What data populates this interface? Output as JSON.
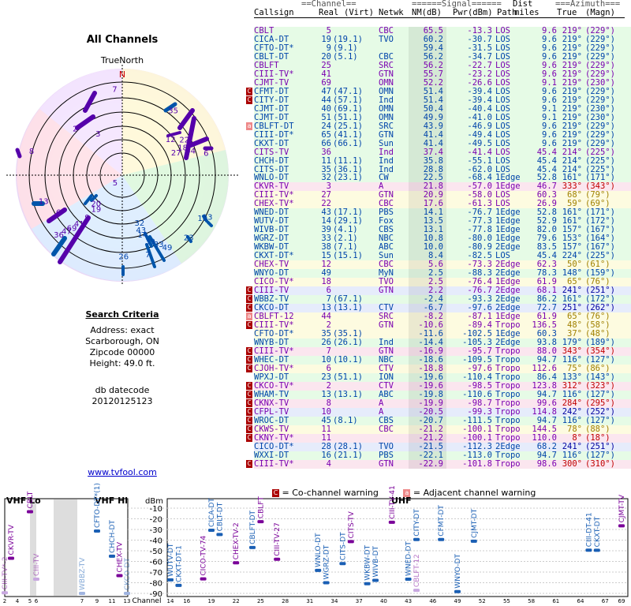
{
  "left": {
    "title": "All Channels",
    "north_label": "TrueNorth",
    "n_label": "N",
    "criteria_title": "Search Criteria",
    "address": "Address: exact",
    "city": "Scarborough, ON",
    "zipcode": "Zipcode 00000",
    "height": "Height: 49.0 ft.",
    "db_label": "db datecode",
    "db_code": "20120125123",
    "link": "www.tvfool.com"
  },
  "table": {
    "group_headers": {
      "channel": "==Channel==",
      "signal": "======Signal======",
      "azimuth": "===Azimuth==="
    },
    "headers": [
      "Callsign",
      "Real",
      "(Virt)",
      "Netwk",
      "NM(dB)",
      "Pwr(dBm)",
      "Path",
      "Dist",
      "miles",
      "True",
      "(Magn)"
    ],
    "rows": [
      [
        "CBLT",
        "5",
        "",
        "CBC",
        "65.5",
        "-13.3",
        "LOS",
        "9.6",
        "219°",
        "(229°)",
        "g",
        "",
        "violet"
      ],
      [
        "CICA-DT",
        "19",
        "(19.1)",
        "TVO",
        "60.2",
        "-30.7",
        "LOS",
        "9.6",
        "219°",
        "(229°)",
        "g",
        "",
        "blue"
      ],
      [
        "CFTO-DT*",
        "9",
        "(9.1)",
        "",
        "59.4",
        "-31.5",
        "LOS",
        "9.6",
        "219°",
        "(229°)",
        "g",
        "",
        "blue"
      ],
      [
        "CBLT-DT",
        "20",
        "(5.1)",
        "CBC",
        "56.2",
        "-34.7",
        "LOS",
        "9.6",
        "219°",
        "(229°)",
        "g",
        "",
        "blue"
      ],
      [
        "CBLFT",
        "25",
        "",
        "SRC",
        "56.2",
        "-22.7",
        "LOS",
        "9.6",
        "219°",
        "(229°)",
        "g",
        "",
        "violet"
      ],
      [
        "CIII-TV*",
        "41",
        "",
        "GTN",
        "55.7",
        "-23.2",
        "LOS",
        "9.6",
        "219°",
        "(229°)",
        "g",
        "",
        "violet"
      ],
      [
        "CJMT-TV",
        "69",
        "",
        "OMN",
        "52.2",
        "-26.6",
        "LOS",
        "9.1",
        "219°",
        "(230°)",
        "g",
        "",
        "violet"
      ],
      [
        "CFMT-DT",
        "47",
        "(47.1)",
        "OMN",
        "51.4",
        "-39.4",
        "LOS",
        "9.6",
        "219°",
        "(229°)",
        "g",
        "C",
        "blue"
      ],
      [
        "CITY-DT",
        "44",
        "(57.1)",
        "Ind",
        "51.4",
        "-39.4",
        "LOS",
        "9.6",
        "219°",
        "(229°)",
        "g",
        "C",
        "blue"
      ],
      [
        "CJMT-DT",
        "40",
        "(69.1)",
        "OMN",
        "50.4",
        "-40.4",
        "LOS",
        "9.1",
        "219°",
        "(230°)",
        "g",
        "",
        "blue"
      ],
      [
        "CJMT-DT",
        "51",
        "(51.1)",
        "OMN",
        "49.9",
        "-41.0",
        "LOS",
        "9.1",
        "219°",
        "(230°)",
        "g",
        "",
        "blue"
      ],
      [
        "CBLFT-DT",
        "24",
        "(25.1)",
        "SRC",
        "43.9",
        "-46.9",
        "LOS",
        "9.6",
        "219°",
        "(229°)",
        "g",
        "a",
        "blue"
      ],
      [
        "CIII-DT*",
        "65",
        "(41.1)",
        "GTN",
        "41.4",
        "-49.4",
        "LOS",
        "9.6",
        "219°",
        "(229°)",
        "g",
        "",
        "blue"
      ],
      [
        "CKXT-DT",
        "66",
        "(66.1)",
        "Sun",
        "41.4",
        "-49.5",
        "LOS",
        "9.6",
        "219°",
        "(229°)",
        "g",
        "",
        "blue"
      ],
      [
        "CITS-TV",
        "36",
        "",
        "Ind",
        "37.4",
        "-41.4",
        "LOS",
        "45.4",
        "214°",
        "(225°)",
        "g",
        "",
        "violet"
      ],
      [
        "CHCH-DT",
        "11",
        "(11.1)",
        "Ind",
        "35.8",
        "-55.1",
        "LOS",
        "45.4",
        "214°",
        "(225°)",
        "g",
        "",
        "blue"
      ],
      [
        "CITS-DT",
        "35",
        "(36.1)",
        "Ind",
        "28.8",
        "-62.0",
        "LOS",
        "45.4",
        "214°",
        "(225°)",
        "g",
        "",
        "blue"
      ],
      [
        "WNLO-DT",
        "32",
        "(23.1)",
        "CW",
        "22.5",
        "-68.4",
        "1Edge",
        "52.8",
        "161°",
        "(171°)",
        "g",
        "",
        "blue"
      ],
      [
        "CKVR-TV",
        "3",
        "",
        "A",
        "21.8",
        "-57.0",
        "1Edge",
        "46.7",
        "333°",
        "(343°)",
        "p",
        "",
        "violet"
      ],
      [
        "CIII-TV*",
        "27",
        "",
        "GTN",
        "20.9",
        "-58.0",
        "LOS",
        "60.3",
        "68°",
        "(79°)",
        "y",
        "",
        "violet"
      ],
      [
        "CHEX-TV*",
        "22",
        "",
        "CBC",
        "17.6",
        "-61.3",
        "LOS",
        "26.9",
        "59°",
        "(69°)",
        "y",
        "",
        "violet"
      ],
      [
        "WNED-DT",
        "43",
        "(17.1)",
        "PBS",
        "14.1",
        "-76.7",
        "1Edge",
        "52.8",
        "161°",
        "(171°)",
        "g",
        "",
        "blue"
      ],
      [
        "WUTV-DT",
        "14",
        "(29.1)",
        "Fox",
        "13.5",
        "-77.3",
        "1Edge",
        "52.9",
        "161°",
        "(172°)",
        "g",
        "",
        "blue"
      ],
      [
        "WIVB-DT",
        "39",
        "(4.1)",
        "CBS",
        "13.1",
        "-77.8",
        "1Edge",
        "82.0",
        "157°",
        "(167°)",
        "g",
        "",
        "blue"
      ],
      [
        "WGRZ-DT",
        "33",
        "(2.1)",
        "NBC",
        "10.8",
        "-80.0",
        "1Edge",
        "79.6",
        "153°",
        "(164°)",
        "g",
        "",
        "blue"
      ],
      [
        "WKBW-DT",
        "38",
        "(7.1)",
        "ABC",
        "10.0",
        "-80.9",
        "2Edge",
        "83.5",
        "157°",
        "(167°)",
        "g",
        "",
        "blue"
      ],
      [
        "CKXT-DT*",
        "15",
        "(15.1)",
        "Sun",
        "8.4",
        "-82.5",
        "LOS",
        "45.4",
        "224°",
        "(225°)",
        "g",
        "",
        "blue"
      ],
      [
        "CHEX-TV",
        "12",
        "",
        "CBC",
        "5.6",
        "-73.3",
        "2Edge",
        "62.3",
        "50°",
        "(61°)",
        "y",
        "",
        "violet"
      ],
      [
        "WNYO-DT",
        "49",
        "",
        "MyN",
        "2.5",
        "-88.3",
        "2Edge",
        "78.3",
        "148°",
        "(159°)",
        "g",
        "",
        "blue"
      ],
      [
        "CICO-TV*",
        "18",
        "",
        "TVO",
        "2.5",
        "-76.4",
        "1Edge",
        "61.9",
        "65°",
        "(76°)",
        "y",
        "",
        "violet"
      ],
      [
        "CIII-TV",
        "6",
        "",
        "GTN",
        "2.2",
        "-76.7",
        "2Edge",
        "68.1",
        "241°",
        "(251°)",
        "b",
        "C",
        "violet"
      ],
      [
        "WBBZ-TV",
        "7",
        "(67.1)",
        "",
        "-2.4",
        "-93.3",
        "2Edge",
        "86.2",
        "161°",
        "(172°)",
        "g",
        "C",
        "blue"
      ],
      [
        "CKCO-DT",
        "13",
        "(13.1)",
        "CTV",
        "-6.7",
        "-97.6",
        "2Edge",
        "72.7",
        "251°",
        "(262°)",
        "b",
        "C",
        "blue"
      ],
      [
        "CBLFT-12",
        "44",
        "",
        "SRC",
        "-8.2",
        "-87.1",
        "1Edge",
        "61.9",
        "65°",
        "(76°)",
        "y",
        "a",
        "violet"
      ],
      [
        "CIII-TV*",
        "2",
        "",
        "GTN",
        "-10.6",
        "-89.4",
        "Tropo",
        "136.5",
        "48°",
        "(58°)",
        "y",
        "C",
        "violet"
      ],
      [
        "CFTO-DT*",
        "35",
        "(35.1)",
        "",
        "-11.6",
        "-102.5",
        "1Edge",
        "60.3",
        "37°",
        "(48°)",
        "y",
        "",
        "blue"
      ],
      [
        "WNYB-DT",
        "26",
        "(26.1)",
        "Ind",
        "-14.4",
        "-105.3",
        "2Edge",
        "93.8",
        "179°",
        "(189°)",
        "g",
        "",
        "blue"
      ],
      [
        "CIII-TV*",
        "7",
        "",
        "GTN",
        "-16.9",
        "-95.7",
        "Tropo",
        "88.0",
        "343°",
        "(354°)",
        "p",
        "C",
        "violet"
      ],
      [
        "WHEC-DT",
        "10",
        "(10.1)",
        "NBC",
        "-18.6",
        "-109.5",
        "Tropo",
        "94.7",
        "116°",
        "(127°)",
        "g",
        "C",
        "blue"
      ],
      [
        "CJOH-TV*",
        "6",
        "",
        "CTV",
        "-18.8",
        "-97.6",
        "Tropo",
        "112.6",
        "75°",
        "(86°)",
        "y",
        "C",
        "violet"
      ],
      [
        "WPXJ-DT",
        "23",
        "(51.1)",
        "ION",
        "-19.6",
        "-110.4",
        "Tropo",
        "86.4",
        "133°",
        "(143°)",
        "g",
        "",
        "blue"
      ],
      [
        "CKCO-TV*",
        "2",
        "",
        "CTV",
        "-19.6",
        "-98.5",
        "Tropo",
        "123.8",
        "312°",
        "(323°)",
        "p",
        "C",
        "violet"
      ],
      [
        "WHAM-TV",
        "13",
        "(13.1)",
        "ABC",
        "-19.8",
        "-110.6",
        "Tropo",
        "94.7",
        "116°",
        "(127°)",
        "g",
        "C",
        "blue"
      ],
      [
        "CKNX-TV",
        "8",
        "",
        "A",
        "-19.9",
        "-98.7",
        "Tropo",
        "99.6",
        "284°",
        "(295°)",
        "p",
        "C",
        "violet"
      ],
      [
        "CFPL-TV",
        "10",
        "",
        "A",
        "-20.5",
        "-99.3",
        "Tropo",
        "114.8",
        "242°",
        "(252°)",
        "b",
        "C",
        "violet"
      ],
      [
        "WROC-DT",
        "45",
        "(8.1)",
        "CBS",
        "-20.7",
        "-111.5",
        "Tropo",
        "94.7",
        "116°",
        "(127°)",
        "g",
        "C",
        "blue"
      ],
      [
        "CKWS-TV",
        "11",
        "",
        "CBC",
        "-21.2",
        "-100.1",
        "Tropo",
        "144.5",
        "78°",
        "(88°)",
        "y",
        "C",
        "violet"
      ],
      [
        "CKNY-TV*",
        "11",
        "",
        "",
        "-21.2",
        "-100.1",
        "Tropo",
        "110.0",
        "8°",
        "(18°)",
        "p",
        "C",
        "violet"
      ],
      [
        "CICO-DT*",
        "28",
        "(28.1)",
        "TVO",
        "-21.5",
        "-112.3",
        "2Edge",
        "68.2",
        "241°",
        "(251°)",
        "b",
        "",
        "blue"
      ],
      [
        "WXXI-DT",
        "16",
        "(21.1)",
        "PBS",
        "-22.1",
        "-113.0",
        "Tropo",
        "94.7",
        "116°",
        "(127°)",
        "g",
        "",
        "blue"
      ],
      [
        "CIII-TV*",
        "4",
        "",
        "GTN",
        "-22.9",
        "-101.8",
        "Tropo",
        "98.6",
        "300°",
        "(310°)",
        "p",
        "C",
        "violet"
      ]
    ]
  },
  "legend": {
    "co_channel": "= Co-channel warning",
    "adjacent": "= Adjacent channel warning",
    "co_mark": "C",
    "adj_mark": "a"
  },
  "chart_data": {
    "type": "bar",
    "title": "",
    "ylabel": "dBm",
    "ylim": [
      -90,
      -10
    ],
    "yticks": [
      -10,
      -20,
      -30,
      -40,
      -50,
      -60,
      -70,
      -80,
      -90
    ],
    "band_labels": [
      "VHF Lo",
      "VHF Hi",
      "UHF"
    ],
    "x_label": "Channel",
    "x_ticks": [
      2,
      4,
      5,
      6,
      7,
      9,
      11,
      13,
      14,
      16,
      19,
      22,
      25,
      28,
      31,
      34,
      37,
      40,
      43,
      46,
      49,
      52,
      55,
      58,
      61,
      64,
      67,
      69
    ],
    "stations": [
      {
        "ch": 2,
        "pwr": -89.4,
        "label": "CIII-TV*-2",
        "kind": "analog_weak"
      },
      {
        "ch": 3,
        "pwr": -57.0,
        "label": "CKVR-TV",
        "kind": "analog"
      },
      {
        "ch": 5,
        "pwr": -13.3,
        "label": "CBLT",
        "kind": "analog"
      },
      {
        "ch": 6,
        "pwr": -76.7,
        "label": "CIII-TV",
        "kind": "analog_weak"
      },
      {
        "ch": 7,
        "pwr": -93.3,
        "label": "WBBZ-TV",
        "kind": "digital_weak"
      },
      {
        "ch": 9,
        "pwr": -31.5,
        "label": "CFTO-DT*(1)",
        "kind": "digital"
      },
      {
        "ch": 11,
        "pwr": -55.1,
        "label": "CHCH-DT",
        "kind": "digital"
      },
      {
        "ch": 12,
        "pwr": -73.3,
        "label": "CHEX-TV",
        "kind": "analog"
      },
      {
        "ch": 13,
        "pwr": -97.6,
        "label": "CKCO-DT",
        "kind": "digital_weak"
      },
      {
        "ch": 14,
        "pwr": -77.3,
        "label": "WUTV-DT",
        "kind": "digital"
      },
      {
        "ch": 15,
        "pwr": -82.5,
        "label": "CKXT-DT-1",
        "kind": "digital"
      },
      {
        "ch": 18,
        "pwr": -76.4,
        "label": "CICO-TV-74",
        "kind": "analog"
      },
      {
        "ch": 19,
        "pwr": -30.7,
        "label": "CICA-DT",
        "kind": "digital"
      },
      {
        "ch": 20,
        "pwr": -34.7,
        "label": "CBLT-DT",
        "kind": "digital"
      },
      {
        "ch": 22,
        "pwr": -61.3,
        "label": "CHEX-TV-2",
        "kind": "analog"
      },
      {
        "ch": 24,
        "pwr": -46.9,
        "label": "CBLFT-DT",
        "kind": "digital"
      },
      {
        "ch": 25,
        "pwr": -22.7,
        "label": "CBLFT",
        "kind": "analog"
      },
      {
        "ch": 27,
        "pwr": -58.0,
        "label": "CIII-TV-27",
        "kind": "analog"
      },
      {
        "ch": 32,
        "pwr": -68.4,
        "label": "WNLO-DT",
        "kind": "digital"
      },
      {
        "ch": 33,
        "pwr": -80.0,
        "label": "WGRZ-DT",
        "kind": "digital"
      },
      {
        "ch": 35,
        "pwr": -62.0,
        "label": "CITS-DT",
        "kind": "digital"
      },
      {
        "ch": 36,
        "pwr": -41.4,
        "label": "CITS-TV",
        "kind": "analog"
      },
      {
        "ch": 38,
        "pwr": -80.9,
        "label": "WKBW-DT",
        "kind": "digital"
      },
      {
        "ch": 39,
        "pwr": -77.8,
        "label": "WIVB-DT",
        "kind": "digital"
      },
      {
        "ch": 41,
        "pwr": -23.2,
        "label": "CIII-TV-41",
        "kind": "analog"
      },
      {
        "ch": 43,
        "pwr": -76.7,
        "label": "WNED-DT",
        "kind": "digital"
      },
      {
        "ch": 44,
        "pwr": -39.4,
        "label": "CITY-DT",
        "kind": "digital"
      },
      {
        "ch": 44,
        "pwr": -87.1,
        "label": "CBLFT-12",
        "kind": "analog_weak"
      },
      {
        "ch": 47,
        "pwr": -39.4,
        "label": "CFMT-DT",
        "kind": "digital"
      },
      {
        "ch": 49,
        "pwr": -88.3,
        "label": "WNYO-DT",
        "kind": "digital"
      },
      {
        "ch": 51,
        "pwr": -41.0,
        "label": "CJMT-DT",
        "kind": "digital"
      },
      {
        "ch": 65,
        "pwr": -49.4,
        "label": "CIII-DT-41",
        "kind": "digital"
      },
      {
        "ch": 66,
        "pwr": -49.5,
        "label": "CKXT-DT",
        "kind": "digital"
      },
      {
        "ch": 69,
        "pwr": -26.6,
        "label": "CJMT-TV",
        "kind": "analog"
      }
    ]
  },
  "radar_data": {
    "markers": [
      {
        "label": "N",
        "az": 0,
        "r": 1.0,
        "color": "#cc0000"
      },
      {
        "label": "7",
        "az": 355,
        "r": 0.86
      },
      {
        "label": "2",
        "az": 315,
        "r": 0.66
      },
      {
        "label": "3",
        "az": 330,
        "r": 0.48
      },
      {
        "label": "8",
        "az": 285,
        "r": 0.93
      },
      {
        "label": "35",
        "az": 38,
        "r": 0.82
      },
      {
        "label": "22",
        "az": 60,
        "r": 0.71
      },
      {
        "label": "18",
        "az": 65,
        "r": 0.66
      },
      {
        "label": "44",
        "az": 70,
        "r": 0.72
      },
      {
        "label": "6",
        "az": 75,
        "r": 0.86
      },
      {
        "label": "27",
        "az": 67,
        "r": 0.58
      },
      {
        "label": "12",
        "az": 53,
        "r": 0.6
      },
      {
        "label": "5",
        "az": 225,
        "r": 0.1
      },
      {
        "label": "13",
        "az": 252,
        "r": 0.82
      },
      {
        "label": "6",
        "az": 240,
        "r": 0.73
      },
      {
        "label": "10",
        "az": 118,
        "r": 0.9
      },
      {
        "label": "13",
        "az": 116,
        "r": 0.94
      },
      {
        "label": "23",
        "az": 133,
        "r": 0.9
      },
      {
        "label": "32",
        "az": 160,
        "r": 0.5
      },
      {
        "label": "43",
        "az": 161,
        "r": 0.57
      },
      {
        "label": "14",
        "az": 161,
        "r": 0.62
      },
      {
        "label": "39",
        "az": 157,
        "r": 0.71
      },
      {
        "label": "33",
        "az": 152,
        "r": 0.77
      },
      {
        "label": "49",
        "az": 148,
        "r": 0.84
      },
      {
        "label": "26",
        "az": 179,
        "r": 0.8
      },
      {
        "label": "7",
        "az": 162,
        "r": 0.82
      },
      {
        "label": "36",
        "az": 227,
        "r": 0.86
      },
      {
        "label": "47",
        "az": 225,
        "r": 0.78
      },
      {
        "label": "69",
        "az": 224,
        "r": 0.72
      },
      {
        "label": "41",
        "az": 222,
        "r": 0.64
      },
      {
        "label": "9",
        "az": 220,
        "r": 0.54
      },
      {
        "label": "19",
        "az": 218,
        "r": 0.42
      },
      {
        "label": "20",
        "az": 223,
        "r": 0.38
      }
    ]
  }
}
